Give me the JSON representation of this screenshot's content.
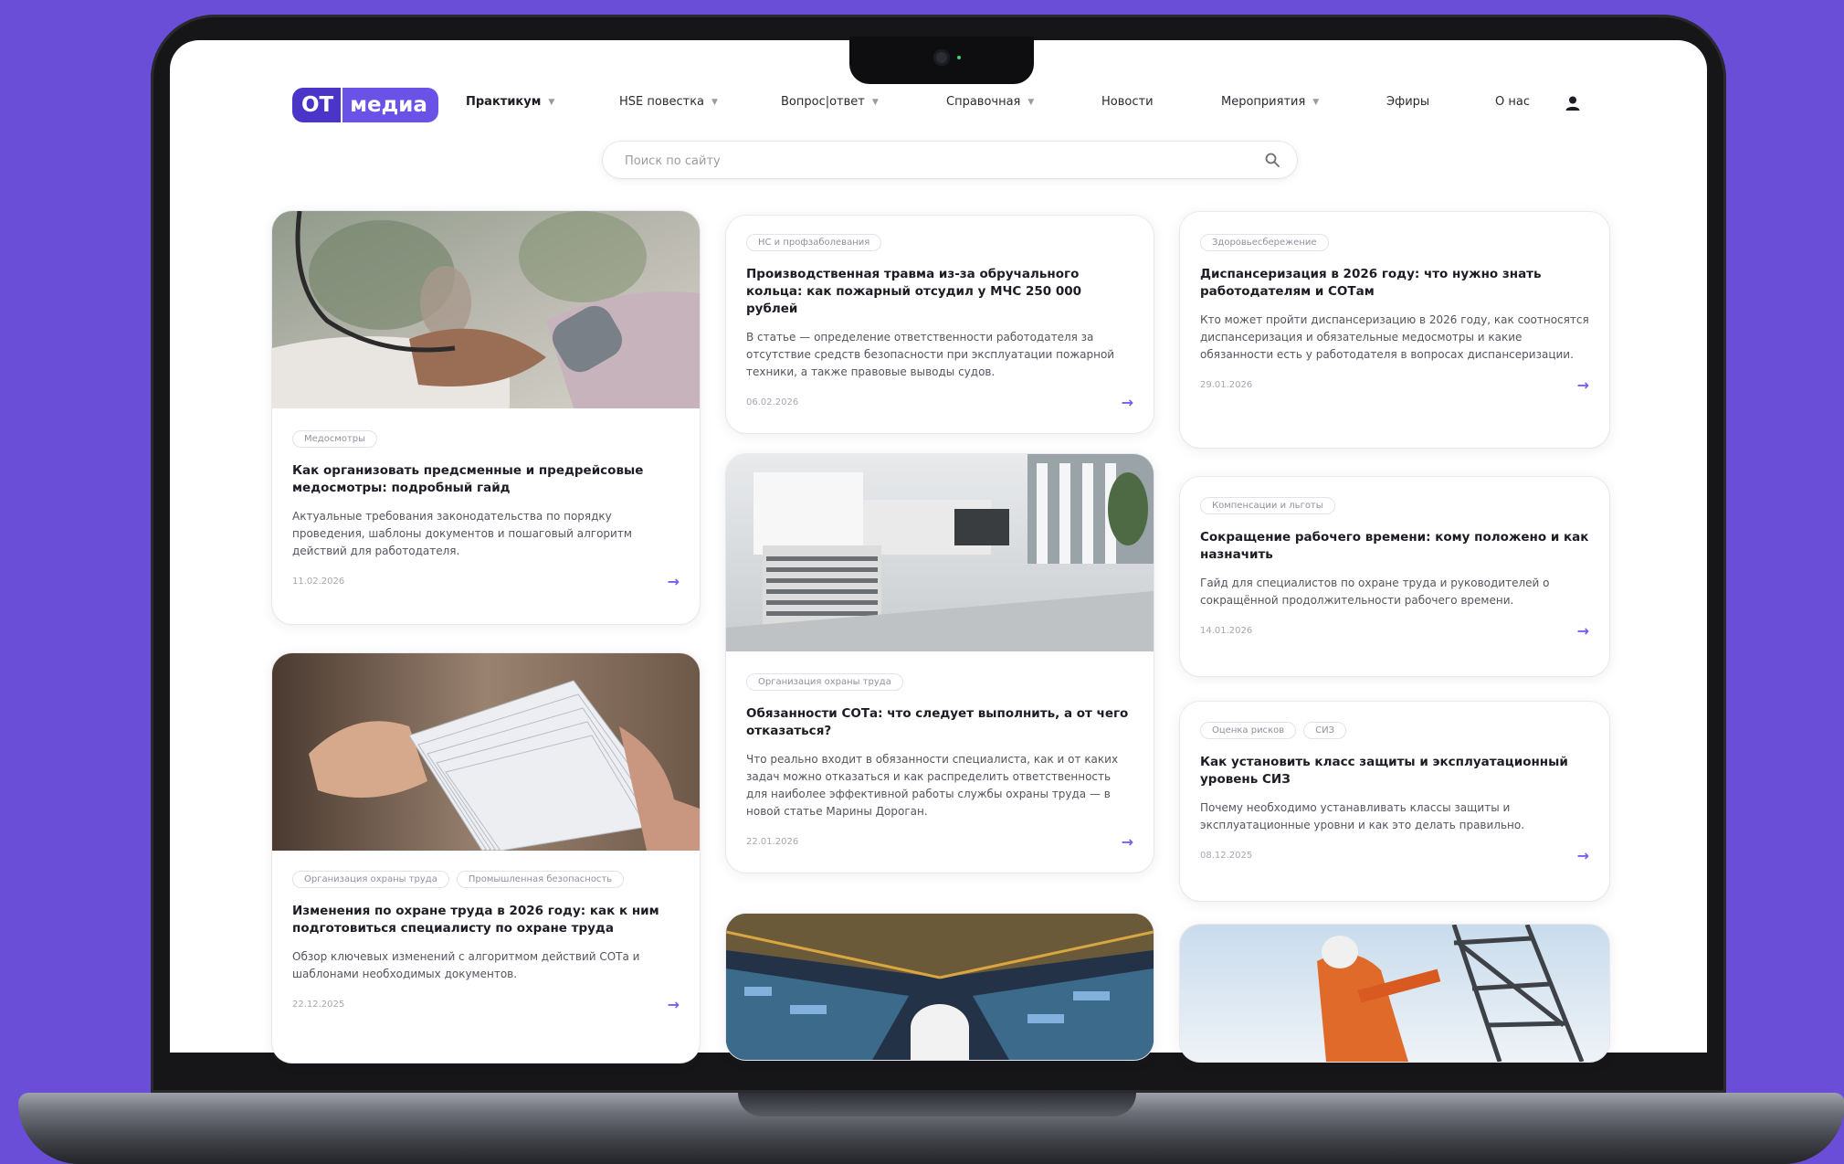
{
  "colors": {
    "accent": "#6a52e6",
    "background": "#6a4ed8",
    "logo_dark": "#4b34c8"
  },
  "logo": {
    "ot": "ОТ",
    "media": "медиа"
  },
  "nav": {
    "items": [
      {
        "label": "Практикум",
        "dropdown": true
      },
      {
        "label": "HSE повестка",
        "dropdown": true
      },
      {
        "label": "Вопрос|ответ",
        "dropdown": true
      },
      {
        "label": "Справочная",
        "dropdown": true
      },
      {
        "label": "Новости",
        "dropdown": false
      },
      {
        "label": "Мероприятия",
        "dropdown": true
      },
      {
        "label": "Эфиры",
        "dropdown": false
      },
      {
        "label": "О нас",
        "dropdown": false
      }
    ],
    "user_icon": "user-icon"
  },
  "search": {
    "placeholder": "Поиск по сайту",
    "icon": "search-icon"
  },
  "cards": [
    {
      "tags": [
        "Медосмотры"
      ],
      "title": "Как организовать предсменные и предрейсовые медосмотры: подробный гайд",
      "desc": "Актуальные требования законодательства по порядку проведения, шаблоны документов и пошаговый алгоритм действий для работодателя.",
      "date": "11.02.2026",
      "image": "blood-pressure-measurement"
    },
    {
      "tags": [
        "НС и профзаболевания"
      ],
      "title": "Производственная травма из-за обручального кольца: как пожарный отсудил у МЧС 250 000 рублей",
      "desc": "В статье — определение ответственности работодателя за отсутствие средств безопасности при эксплуатации пожарной техники, а также правовые выводы судов.",
      "date": "06.02.2026"
    },
    {
      "tags": [
        "Здоровьесбережение"
      ],
      "title": "Диспансеризация в 2026 году: что нужно знать работодателям и СОТам",
      "desc": "Кто может пройти диспансеризацию в 2026 году, как соотносятся диспансеризация и обязательные медосмотры и какие обязанности есть у работодателя в вопросах диспансеризации.",
      "date": "29.01.2026"
    },
    {
      "tags": [
        "Организация охраны труда"
      ],
      "title": "Обязанности СОТа: что следует выполнить, а от чего отказаться?",
      "desc": "Что реально входит в обязанности специалиста, как и от каких задач можно отказаться и как распределить ответственность для наиболее эффективной работы службы охраны труда — в новой статье Марины Дороган.",
      "date": "22.01.2026",
      "image": "office-documents"
    },
    {
      "tags": [
        "Компенсации и льготы"
      ],
      "title": "Сокращение рабочего времени: кому положено и как назначить",
      "desc": "Гайд для специалистов по охране труда и руководителей о сокращённой продолжительности рабочего времени.",
      "date": "14.01.2026"
    },
    {
      "tags": [
        "Организация охраны труда",
        "Промышленная безопасность"
      ],
      "title": "Изменения по охране труда в 2026 году: как к ним подготовиться специалисту по охране труда",
      "desc": "Обзор ключевых изменений с алгоритмом действий СОТа и шаблонами необходимых документов.",
      "date": "22.12.2025",
      "image": "paper-stack"
    },
    {
      "tags": [
        "Оценка рисков",
        "СИЗ"
      ],
      "title": "Как установить класс защиты и эксплуатационный уровень СИЗ",
      "desc": "Почему необходимо устанавливать классы защиты и эксплуатационные уровни и как это делать правильно.",
      "date": "08.12.2025"
    },
    {
      "tags": [],
      "title": "",
      "desc": "",
      "date": "",
      "image": "factory-hall"
    },
    {
      "tags": [],
      "title": "",
      "desc": "",
      "date": "",
      "image": "tower-worker"
    }
  ]
}
